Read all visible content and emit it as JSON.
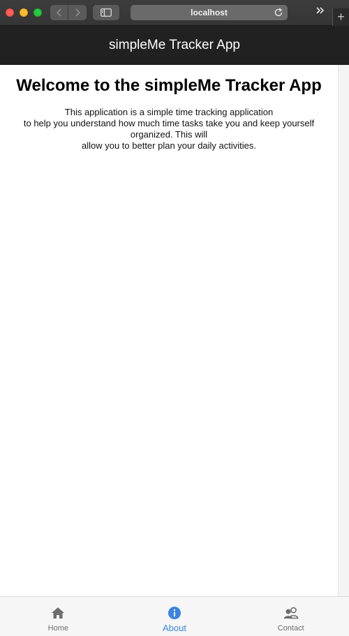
{
  "browser": {
    "url": "localhost",
    "new_tab_symbol": "+"
  },
  "app": {
    "title": "simpleMe Tracker App"
  },
  "page": {
    "heading": "Welcome to the simpleMe Tracker App",
    "body_lines": [
      "This application is a simple time tracking application",
      "to help you understand how much time tasks take you and keep yourself organized. This will",
      "allow you to better plan your daily activities."
    ]
  },
  "bottom_nav": {
    "tabs": [
      {
        "label": "Home",
        "icon": "home-icon",
        "active": false
      },
      {
        "label": "About",
        "icon": "info-icon",
        "active": true
      },
      {
        "label": "Contact",
        "icon": "contact-icon",
        "active": false
      }
    ]
  },
  "colors": {
    "header_bg": "#212121",
    "active_tab": "#3b84e0",
    "inactive_tab": "#6e6e6e"
  }
}
